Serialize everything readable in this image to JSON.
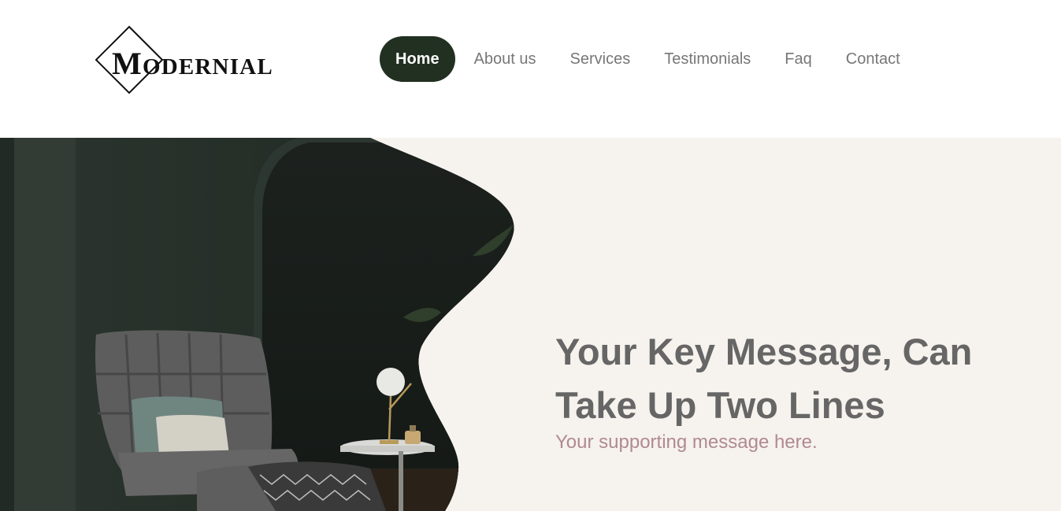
{
  "brand": {
    "logo_initial": "M",
    "logo_rest": "ODERNIAL"
  },
  "nav": {
    "items": [
      {
        "label": "Home",
        "active": true
      },
      {
        "label": "About us",
        "active": false
      },
      {
        "label": "Services",
        "active": false
      },
      {
        "label": "Testimonials",
        "active": false
      },
      {
        "label": "Faq",
        "active": false
      },
      {
        "label": "Contact",
        "active": false
      }
    ]
  },
  "hero": {
    "title_line1": "Your Key Message, Can",
    "title_line2": "Take Up Two Lines",
    "subtitle": "Your supporting message here."
  },
  "colors": {
    "nav_active_bg": "#223021",
    "hero_bg": "#f6f2ed",
    "title_color": "#666666",
    "subtitle_color": "#b08a90"
  }
}
